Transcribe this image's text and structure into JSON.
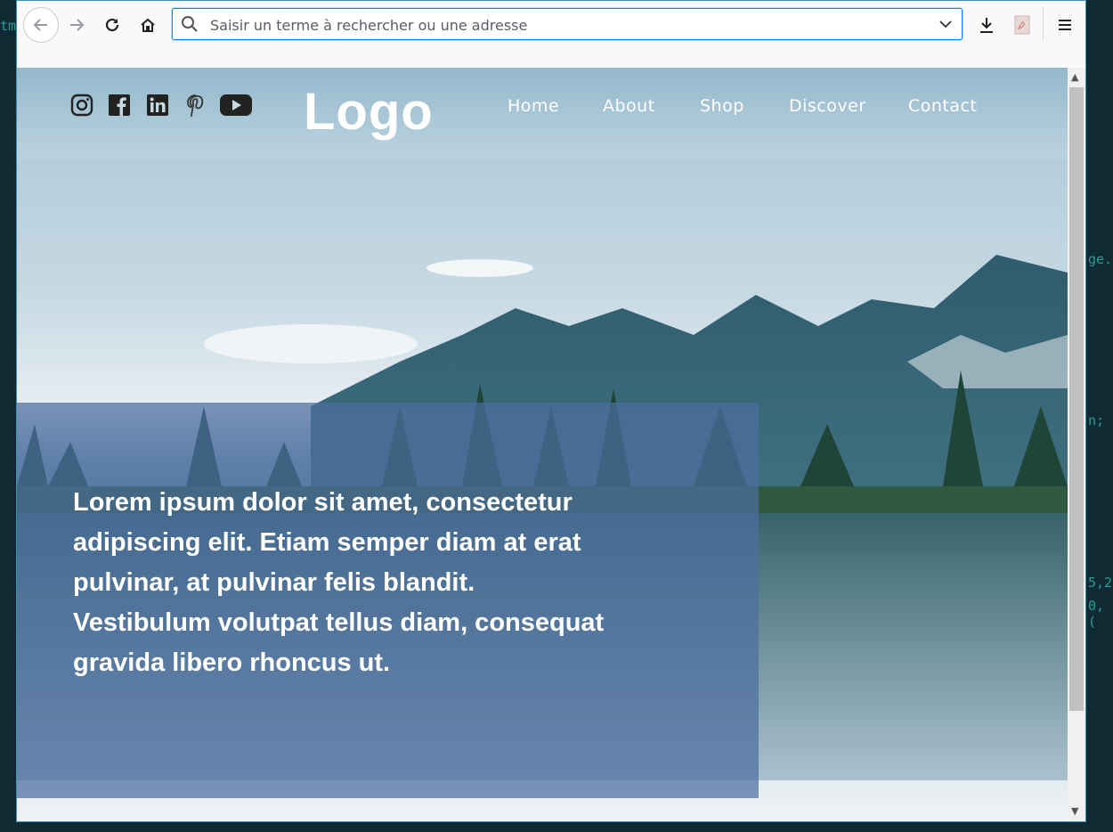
{
  "bg_editor": {
    "frag_top": "tm",
    "frag_1": "ge.",
    "frag_2": "n;",
    "frag_3": "5,2",
    "frag_4": "0, ("
  },
  "browser": {
    "url_placeholder": "Saisir un terme à rechercher ou une adresse",
    "icons": [
      "back-arrow-icon",
      "forward-arrow-icon",
      "reload-icon",
      "home-icon",
      "search-icon",
      "chevron-down-icon",
      "download-icon",
      "pdf-icon",
      "hamburger-menu-icon"
    ]
  },
  "site": {
    "logo": "Logo",
    "social": [
      "instagram-icon",
      "facebook-icon",
      "linkedin-icon",
      "pinterest-icon",
      "youtube-icon"
    ],
    "nav": [
      "Home",
      "About",
      "Shop",
      "Discover",
      "Contact"
    ],
    "hero_text": "Lorem ipsum dolor sit amet, consectetur adipiscing elit. Etiam semper diam at erat pulvinar, at pulvinar felis blandit. Vestibulum volutpat tellus diam, consequat gravida libero rhoncus ut."
  },
  "colors": {
    "accent": "#0a84ff",
    "overlay": "#4c6ea0"
  }
}
